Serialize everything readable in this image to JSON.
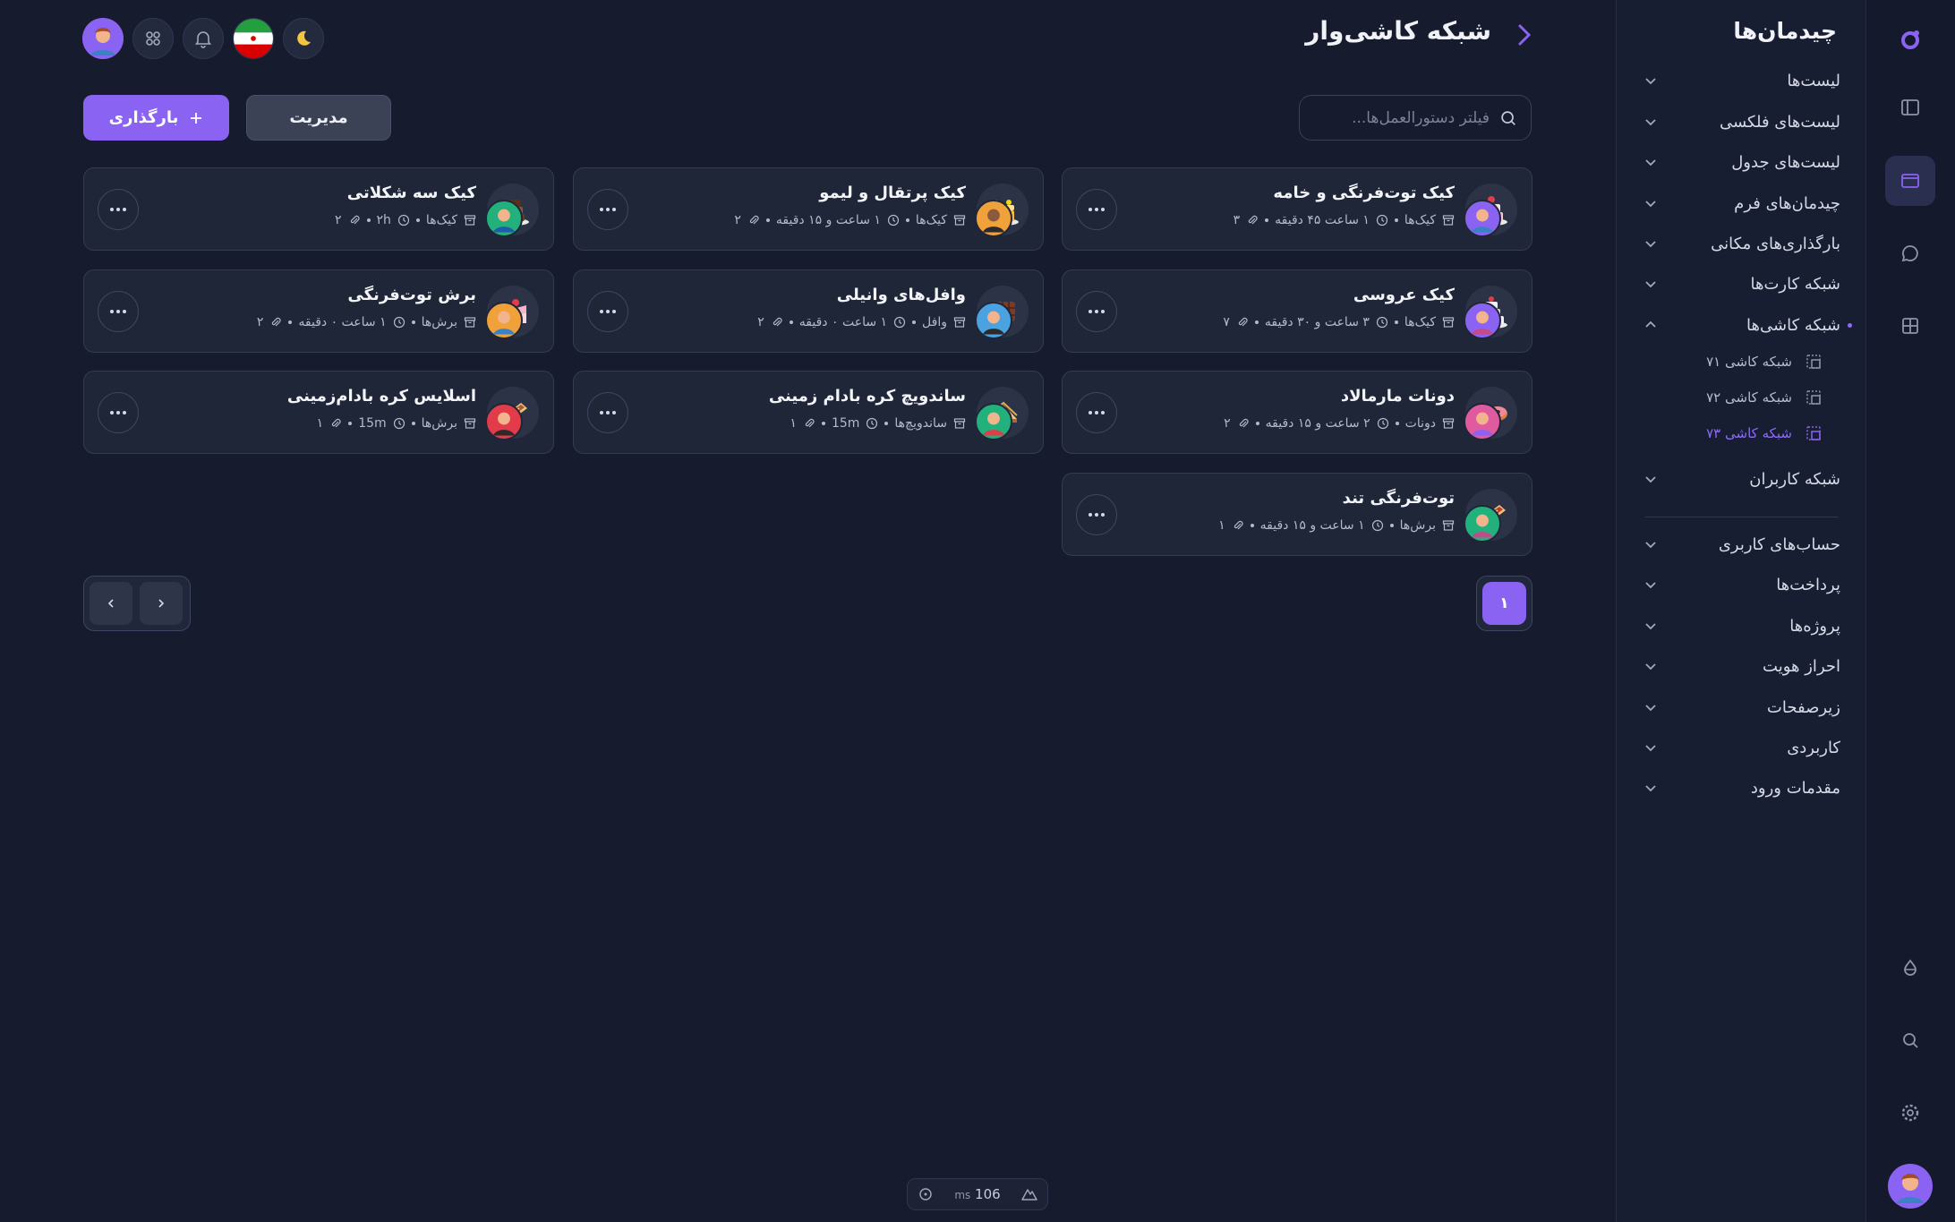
{
  "header": {
    "title": "شبکه کاشی‌وار"
  },
  "toolbar": {
    "search_placeholder": "فیلتر دستورالعمل‌ها...",
    "manage_label": "مدیریت",
    "upload_label": "بارگذاری"
  },
  "sidebar": {
    "title": "چیدمان‌ها",
    "items": [
      {
        "label": "لیست‌ها"
      },
      {
        "label": "لیست‌های فلکسی"
      },
      {
        "label": "لیست‌های جدول"
      },
      {
        "label": "چیدمان‌های فرم"
      },
      {
        "label": "بارگذاری‌های مکانی"
      },
      {
        "label": "شبکه کارت‌ها"
      },
      {
        "label": "شبکه کاشی‌ها"
      },
      {
        "label": "شبکه کاربران"
      }
    ],
    "sub_items": [
      {
        "label": "شبکه کاشی ۷۱"
      },
      {
        "label": "شبکه کاشی ۷۲"
      },
      {
        "label": "شبکه کاشی ۷۳"
      }
    ],
    "bottom_items": [
      {
        "label": "حساب‌های کاربری"
      },
      {
        "label": "پرداخت‌ها"
      },
      {
        "label": "پروژه‌ها"
      },
      {
        "label": "احراز هویت"
      },
      {
        "label": "زیرصفحات"
      },
      {
        "label": "کاربردی"
      },
      {
        "label": "مقدمات ورود"
      }
    ]
  },
  "cards": [
    {
      "title": "کیک توت‌فرنگی و خامه",
      "category": "کیک‌ها",
      "time": "۱ ساعت ۴۵ دقیقه",
      "attachments": "۳"
    },
    {
      "title": "کیک پرتقال و لیمو",
      "category": "کیک‌ها",
      "time": "۱ ساعت و ۱۵ دقیقه",
      "attachments": "۲"
    },
    {
      "title": "کیک سه شکلاتی",
      "category": "کیک‌ها",
      "time": "۲h",
      "attachments": "۲"
    },
    {
      "title": "کیک عروسی",
      "category": "کیک‌ها",
      "time": "۳ ساعت و ۳۰ دقیقه",
      "attachments": "۷"
    },
    {
      "title": "وافل‌های وانیلی",
      "category": "وافل",
      "time": "۱ ساعت ۰ دقیقه",
      "attachments": "۲"
    },
    {
      "title": "برش توت‌فرنگی",
      "category": "برش‌ها",
      "time": "۱ ساعت ۰ دقیقه",
      "attachments": "۲"
    },
    {
      "title": "دونات مارمالاد",
      "category": "دونات",
      "time": "۲ ساعت و ۱۵ دقیقه",
      "attachments": "۲"
    },
    {
      "title": "ساندویچ کره بادام زمینی",
      "category": "ساندویچ‌ها",
      "time": "15m",
      "attachments": "۱"
    },
    {
      "title": "اسلایس کره بادام‌زمینی",
      "category": "برش‌ها",
      "time": "15m",
      "attachments": "۱"
    },
    {
      "title": "توت‌فرنگی تند",
      "category": "برش‌ها",
      "time": "۱ ساعت و ۱۵ دقیقه",
      "attachments": "۱"
    }
  ],
  "pagination": {
    "current_page": "۱"
  },
  "devbar": {
    "ms_value": "106",
    "ms_unit": "ms"
  },
  "colors": {
    "accent": "#8a63f2",
    "background": "#161b2e",
    "card": "#1f2637"
  }
}
